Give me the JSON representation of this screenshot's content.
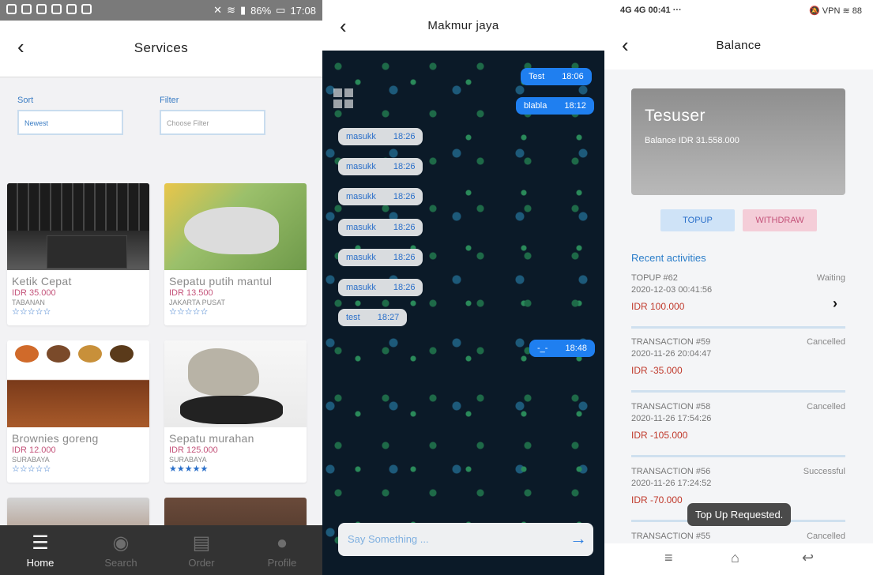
{
  "services": {
    "status_bar": {
      "battery": "86%",
      "time": "17:08"
    },
    "title": "Services",
    "sort_label": "Sort",
    "sort_value": "Newest",
    "filter_label": "Filter",
    "filter_placeholder": "Choose Filter",
    "products": [
      {
        "name": "Ketik Cepat",
        "price": "IDR 35.000",
        "location": "TABANAN",
        "rating": 0,
        "stars": "☆☆☆☆☆"
      },
      {
        "name": "Sepatu putih mantul",
        "price": "IDR 13.500",
        "location": "JAKARTA PUSAT",
        "rating": 0,
        "stars": "☆☆☆☆☆"
      },
      {
        "name": "Brownies goreng",
        "price": "IDR 12.000",
        "location": "SURABAYA",
        "rating": 0,
        "stars": "☆☆☆☆☆"
      },
      {
        "name": "Sepatu murahan",
        "price": "IDR 125.000",
        "location": "SURABAYA",
        "rating": 5,
        "stars": "★★★★★"
      }
    ],
    "nav": [
      {
        "label": "Home",
        "icon": "home-icon"
      },
      {
        "label": "Search",
        "icon": "compass-icon"
      },
      {
        "label": "Order",
        "icon": "list-icon"
      },
      {
        "label": "Profile",
        "icon": "person-icon"
      }
    ],
    "colors": {
      "accent": "#3b7dc4",
      "price": "#c4537a",
      "nav_bg": "#333333"
    }
  },
  "chat": {
    "title": "Makmur jaya",
    "messages": [
      {
        "text": "Test",
        "time": "18:06",
        "dir": "out"
      },
      {
        "text": "blabla",
        "time": "18:12",
        "dir": "out"
      },
      {
        "text": "masukk",
        "time": "18:26",
        "dir": "in"
      },
      {
        "text": "masukk",
        "time": "18:26",
        "dir": "in"
      },
      {
        "text": "masukk",
        "time": "18:26",
        "dir": "in"
      },
      {
        "text": "masukk",
        "time": "18:26",
        "dir": "in"
      },
      {
        "text": "masukk",
        "time": "18:26",
        "dir": "in"
      },
      {
        "text": "masukk",
        "time": "18:26",
        "dir": "in"
      },
      {
        "text": "test",
        "time": "18:27",
        "dir": "in"
      },
      {
        "text": "-_-",
        "time": "18:48",
        "dir": "out"
      }
    ],
    "input_placeholder": "Say Something ...",
    "colors": {
      "out_bubble": "#1f7ff0",
      "in_bubble": "#d9dcdf"
    }
  },
  "balance": {
    "status_bar": {
      "time": "00:41",
      "network": "4G",
      "battery": "88"
    },
    "title": "Balance",
    "user": "Tesuser",
    "balance_text": "Balance IDR 31.558.000",
    "topup_label": "TOPUP",
    "withdraw_label": "WITHDRAW",
    "recent_label": "Recent activities",
    "activities": [
      {
        "title": "TOPUP #62",
        "date": "2020-12-03 00:41:56",
        "amount": "IDR 100.000",
        "status": "Waiting"
      },
      {
        "title": "TRANSACTION #59",
        "date": "2020-11-26 20:04:47",
        "amount": "IDR -35.000",
        "status": "Cancelled"
      },
      {
        "title": "TRANSACTION #58",
        "date": "2020-11-26 17:54:26",
        "amount": "IDR -105.000",
        "status": "Cancelled"
      },
      {
        "title": "TRANSACTION #56",
        "date": "2020-11-26 17:24:52",
        "amount": "IDR -70.000",
        "status": "Successful"
      },
      {
        "title": "TRANSACTION #55",
        "date": "",
        "amount": "",
        "status": "Cancelled"
      }
    ],
    "toast": "Top Up Requested.",
    "colors": {
      "topup": "#cfe3f7",
      "withdraw": "#f4cdd8",
      "amount": "#c0392b"
    }
  }
}
